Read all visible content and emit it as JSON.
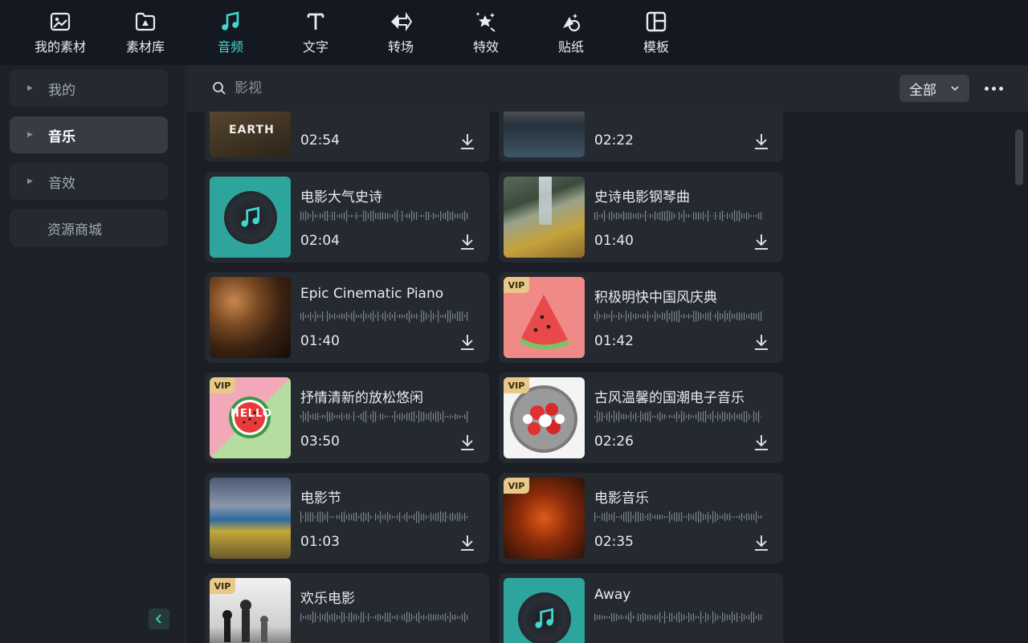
{
  "toolbar": {
    "items": [
      {
        "label": "我的素材",
        "icon": "my-media-icon"
      },
      {
        "label": "素材库",
        "icon": "library-icon"
      },
      {
        "label": "音频",
        "icon": "music-note-icon",
        "active": true
      },
      {
        "label": "文字",
        "icon": "text-icon"
      },
      {
        "label": "转场",
        "icon": "transition-icon"
      },
      {
        "label": "特效",
        "icon": "effects-icon"
      },
      {
        "label": "贴纸",
        "icon": "sticker-icon"
      },
      {
        "label": "模板",
        "icon": "template-icon"
      }
    ]
  },
  "sidebar": {
    "items": [
      {
        "label": "我的"
      },
      {
        "label": "音乐"
      },
      {
        "label": "音效"
      },
      {
        "label": "资源商城"
      }
    ]
  },
  "search": {
    "placeholder": "影视"
  },
  "filter": {
    "value": "全部"
  },
  "tracks": [
    {
      "title": "",
      "duration": "02:54",
      "thumb_text": "EARTH"
    },
    {
      "title": "",
      "duration": "02:22"
    },
    {
      "title": "电影大气史诗",
      "duration": "02:04"
    },
    {
      "title": "史诗电影钢琴曲",
      "duration": "01:40"
    },
    {
      "title": "Epic Cinematic Piano",
      "duration": "01:40"
    },
    {
      "title": "积极明快中国风庆典",
      "duration": "01:42",
      "vip": "VIP"
    },
    {
      "title": "抒情清新的放松悠闲",
      "duration": "03:50",
      "vip": "VIP",
      "thumb_text": "HELLO SUMMER"
    },
    {
      "title": "古风温馨的国潮电子音乐",
      "duration": "02:26",
      "vip": "VIP"
    },
    {
      "title": "电影节",
      "duration": "01:03"
    },
    {
      "title": "电影音乐",
      "duration": "02:35",
      "vip": "VIP"
    },
    {
      "title": "欢乐电影",
      "duration": "",
      "vip": "VIP"
    },
    {
      "title": "Away",
      "duration": ""
    }
  ],
  "colors": {
    "accent": "#3fd8d0",
    "vip": "#e8c98a",
    "card": "#252a31",
    "sidebar_active": "#363b44"
  }
}
